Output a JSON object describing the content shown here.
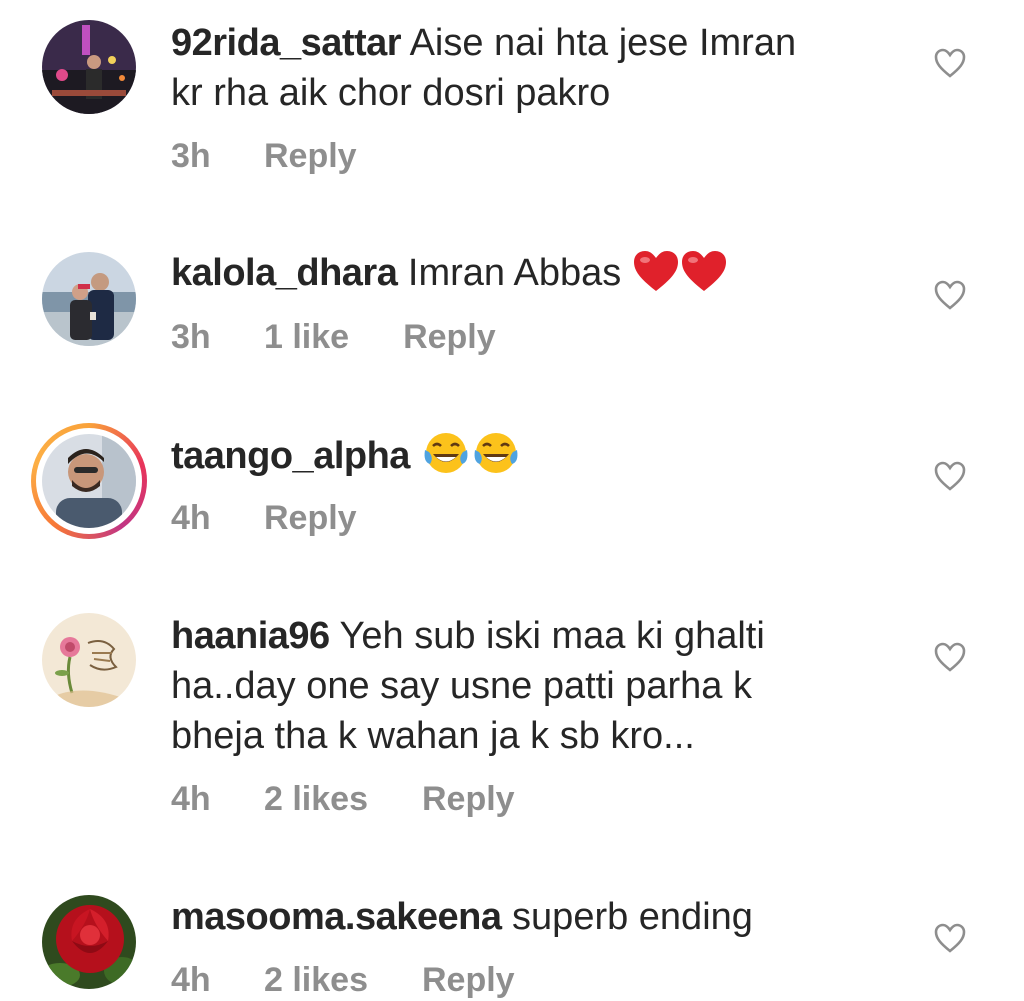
{
  "comments": [
    {
      "username": "92rida_sattar",
      "text_line1": "Aise nai hta jese Imran",
      "text_line2": "kr rha aik chor dosri pakro",
      "time": "3h",
      "likes": "",
      "reply": "Reply"
    },
    {
      "username": "kalola_dhara",
      "text": "Imran Abbas",
      "emoji": "red-heart-emoji x2",
      "time": "3h",
      "likes": "1 like",
      "reply": "Reply"
    },
    {
      "username": "taango_alpha",
      "emoji": "tears-of-joy-emoji x2",
      "time": "4h",
      "likes": "",
      "reply": "Reply"
    },
    {
      "username": "haania96",
      "text_line1": "Yeh sub iski maa ki ghalti",
      "text_line2": "ha..day one say usne patti parha k",
      "text_line3": "bheja tha k wahan ja k sb kro...",
      "time": "4h",
      "likes": "2 likes",
      "reply": "Reply"
    },
    {
      "username": "masooma.sakeena",
      "text": "superb ending",
      "time": "4h",
      "likes": "2 likes",
      "reply": "Reply"
    }
  ],
  "colors": {
    "text": "#262626",
    "meta": "#8e8e8e",
    "heart_outline": "#8e8e8e"
  },
  "icons": [
    "heart-outline-icon",
    "story-ring"
  ]
}
